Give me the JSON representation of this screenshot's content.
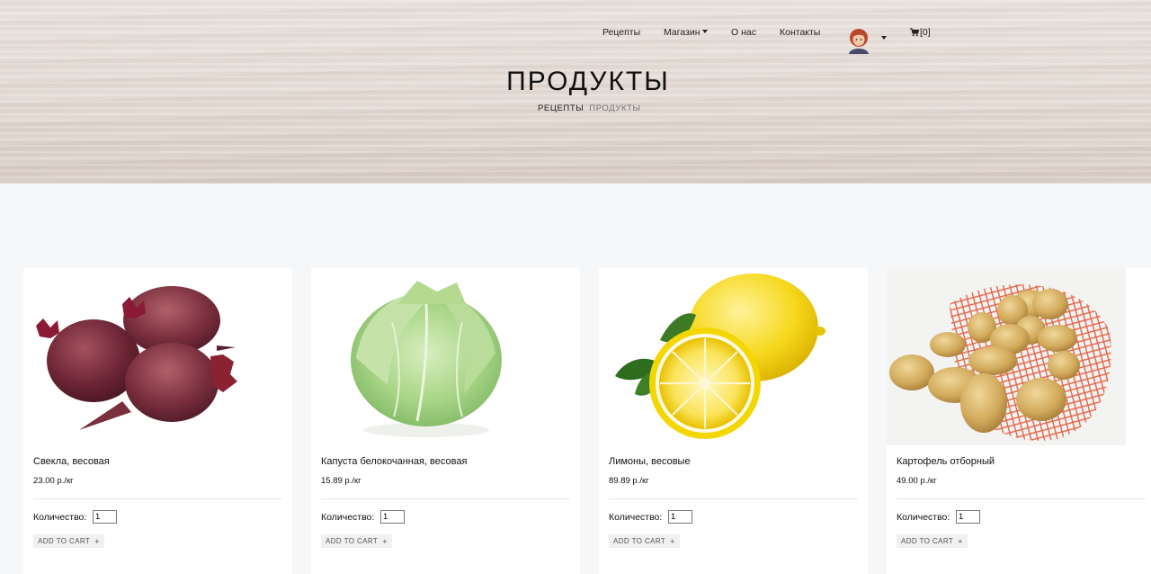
{
  "nav": {
    "items": [
      {
        "label": "Рецепты"
      },
      {
        "label": "Магазин"
      },
      {
        "label": "О нас"
      },
      {
        "label": "Контакты"
      }
    ],
    "cart_count": "[0]"
  },
  "page_title": "ПРОДУКТЫ",
  "breadcrumb": {
    "link": "РЕЦЕПТЫ",
    "current": "ПРОДУКТЫ"
  },
  "qty_label": "Количество:",
  "add_to_cart_label": "ADD TO CART",
  "add_plus": "+",
  "products": [
    {
      "name": "Свекла, весовая",
      "price": "23.00 р./кг",
      "qty": "1"
    },
    {
      "name": "Капуста белокочанная, весовая",
      "price": "15.89 р./кг",
      "qty": "1"
    },
    {
      "name": "Лимоны, весовые",
      "price": "89.89 р./кг",
      "qty": "1"
    },
    {
      "name": "Картофель отборный",
      "price": "49.00 р./кг",
      "qty": "1"
    }
  ]
}
